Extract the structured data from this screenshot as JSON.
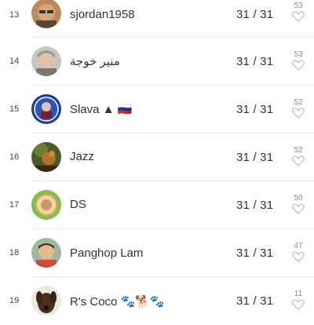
{
  "leaderboard": {
    "rows": [
      {
        "rank": "13",
        "name": "sjordan1958",
        "score": "31 / 31",
        "likes": "53",
        "avatar": "person-glasses-avatar"
      },
      {
        "rank": "14",
        "name": "منير خوجة",
        "score": "31 / 31",
        "likes": "53",
        "avatar": "person-grey-hair-avatar"
      },
      {
        "rank": "15",
        "name": "Slava ▲ 🇷🇺",
        "score": "31 / 31",
        "likes": "52",
        "avatar": "badge-avatar"
      },
      {
        "rank": "16",
        "name": "Jazz",
        "score": "31 / 31",
        "likes": "52",
        "avatar": "squirrel-avatar"
      },
      {
        "rank": "17",
        "name": "DS",
        "score": "31 / 31",
        "likes": "50",
        "avatar": "green-ring-avatar"
      },
      {
        "rank": "18",
        "name": "Panghop  Lam",
        "score": "31 / 31",
        "likes": "47",
        "avatar": "person-smiling-avatar"
      },
      {
        "rank": "19",
        "name": "R's Coco 🐾🐕🐾",
        "score": "31 / 31",
        "likes": "11",
        "avatar": "dog-avatar"
      }
    ]
  },
  "colors": {
    "text": "#333333",
    "muted": "#888888",
    "divider": "#e8e8e8",
    "heart_outline": "#bbbbbb"
  }
}
